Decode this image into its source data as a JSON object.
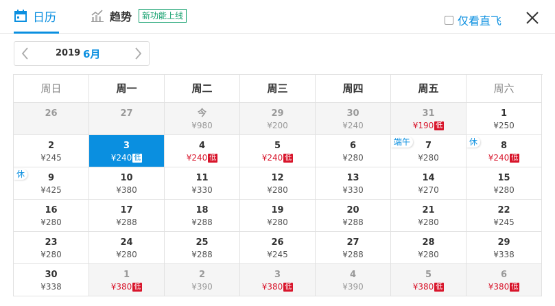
{
  "tabs": {
    "calendar": "日历",
    "trend": "趋势",
    "trend_badge": "新功能上线"
  },
  "direct_only": {
    "label": "仅看直飞",
    "checked": false
  },
  "month_selector": {
    "year": "2019",
    "month": "6月"
  },
  "weekdays": [
    "周日",
    "周一",
    "周二",
    "周三",
    "周四",
    "周五",
    "周六"
  ],
  "weeks": [
    [
      {
        "day": "26",
        "price": "",
        "other": true
      },
      {
        "day": "27",
        "price": "",
        "other": true
      },
      {
        "day": "今",
        "price": "¥980",
        "other": true
      },
      {
        "day": "29",
        "price": "¥200",
        "other": true
      },
      {
        "day": "30",
        "price": "¥240",
        "other": true
      },
      {
        "day": "31",
        "price": "¥190",
        "other": true,
        "low": true,
        "tag": "低"
      },
      {
        "day": "1",
        "price": "¥250"
      }
    ],
    [
      {
        "day": "2",
        "price": "¥245"
      },
      {
        "day": "3",
        "price": "¥240",
        "low": true,
        "tag": "低",
        "selected": true
      },
      {
        "day": "4",
        "price": "¥240",
        "low": true,
        "tag": "低"
      },
      {
        "day": "5",
        "price": "¥240",
        "low": true,
        "tag": "低"
      },
      {
        "day": "6",
        "price": "¥280"
      },
      {
        "day": "7",
        "price": "¥280",
        "holiday": "端午"
      },
      {
        "day": "8",
        "price": "¥240",
        "low": true,
        "tag": "低",
        "holiday": "休"
      }
    ],
    [
      {
        "day": "9",
        "price": "¥425",
        "holiday": "休"
      },
      {
        "day": "10",
        "price": "¥380"
      },
      {
        "day": "11",
        "price": "¥330"
      },
      {
        "day": "12",
        "price": "¥280"
      },
      {
        "day": "13",
        "price": "¥330"
      },
      {
        "day": "14",
        "price": "¥270"
      },
      {
        "day": "15",
        "price": "¥280"
      }
    ],
    [
      {
        "day": "16",
        "price": "¥280"
      },
      {
        "day": "17",
        "price": "¥288"
      },
      {
        "day": "18",
        "price": "¥288"
      },
      {
        "day": "19",
        "price": "¥280"
      },
      {
        "day": "20",
        "price": "¥288"
      },
      {
        "day": "21",
        "price": "¥280"
      },
      {
        "day": "22",
        "price": "¥245"
      }
    ],
    [
      {
        "day": "23",
        "price": "¥280"
      },
      {
        "day": "24",
        "price": "¥280"
      },
      {
        "day": "25",
        "price": "¥288"
      },
      {
        "day": "26",
        "price": "¥245"
      },
      {
        "day": "27",
        "price": "¥288"
      },
      {
        "day": "28",
        "price": "¥280"
      },
      {
        "day": "29",
        "price": "¥338"
      }
    ],
    [
      {
        "day": "30",
        "price": "¥338"
      },
      {
        "day": "1",
        "price": "¥380",
        "other": true,
        "low": true,
        "tag": "低"
      },
      {
        "day": "2",
        "price": "¥390",
        "other": true
      },
      {
        "day": "3",
        "price": "¥380",
        "other": true,
        "low": true,
        "tag": "低"
      },
      {
        "day": "4",
        "price": "¥390",
        "other": true
      },
      {
        "day": "5",
        "price": "¥380",
        "other": true,
        "low": true,
        "tag": "低"
      },
      {
        "day": "6",
        "price": "¥380",
        "other": true,
        "low": true,
        "tag": "低"
      }
    ]
  ],
  "colors": {
    "accent": "#0a8fe0",
    "low_price": "#d8152b",
    "new_badge": "#14a06e"
  }
}
